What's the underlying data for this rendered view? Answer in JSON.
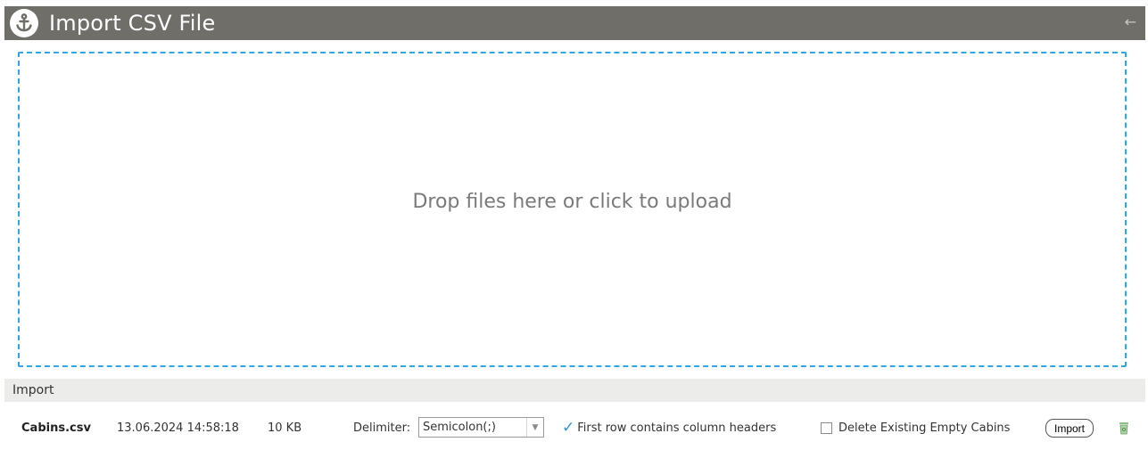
{
  "header": {
    "title": "Import CSV File",
    "back_icon": "←",
    "logo_icon": "anchor-icon",
    "bar_color": "#6f6e69"
  },
  "dropzone": {
    "text": "Drop files here or click to upload",
    "border_color": "#2fa7e6"
  },
  "import_section": {
    "label": "Import"
  },
  "file": {
    "name": "Cabins.csv",
    "date": "13.06.2024 14:58:18",
    "size": "10 KB",
    "delimiter_label": "Delimiter:",
    "delimiter_value": "Semicolon(;)",
    "first_row_headers_label": "First row contains column headers",
    "first_row_headers_checked": true,
    "delete_empty_label": "Delete Existing Empty Cabins",
    "delete_empty_checked": false,
    "import_button": "Import",
    "delete_icon": "trash-icon"
  }
}
